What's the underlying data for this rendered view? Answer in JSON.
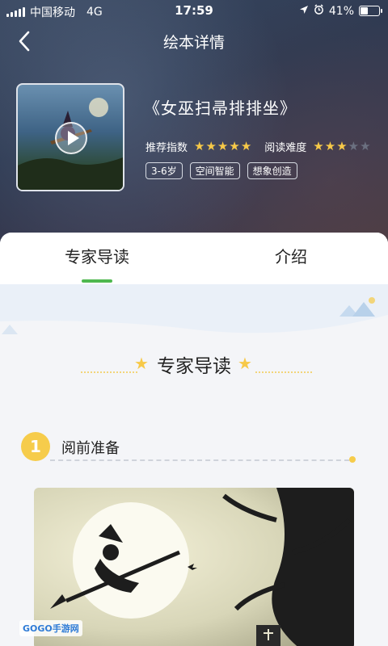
{
  "status": {
    "carrier": "中国移动",
    "network": "4G",
    "time": "17:59",
    "battery": "41%",
    "battery_level": 0.41
  },
  "nav": {
    "title": "绘本详情"
  },
  "book": {
    "title": "《女巫扫帚排排坐》",
    "recommend_label": "推荐指数",
    "recommend_stars": 5,
    "difficulty_label": "阅读难度",
    "difficulty_stars": 3,
    "tags": [
      "3-6岁",
      "空间智能",
      "想象创造"
    ]
  },
  "tabs": [
    {
      "label": "专家导读"
    },
    {
      "label": "介绍"
    }
  ],
  "section": {
    "title": "专家导读"
  },
  "steps": [
    {
      "number": "1",
      "title": "阅前准备"
    }
  ],
  "watermark": "GOGO手游网"
}
